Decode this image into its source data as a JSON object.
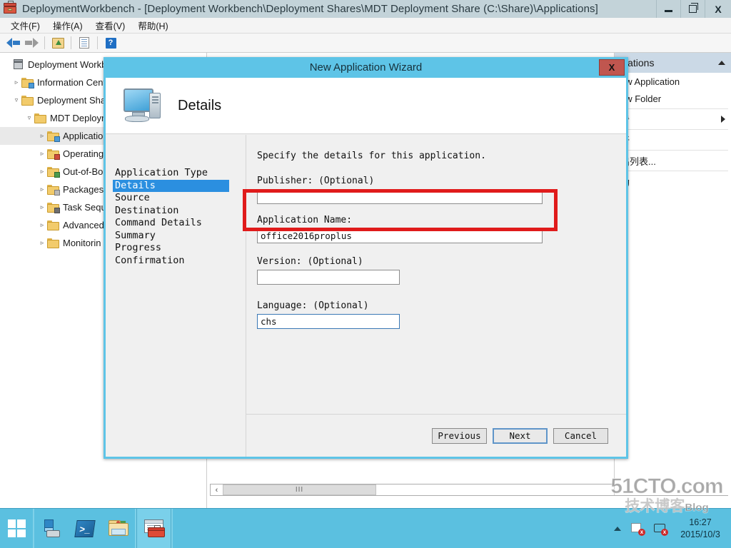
{
  "window": {
    "title": "DeploymentWorkbench - [Deployment Workbench\\Deployment Shares\\MDT Deployment Share (C:\\Share)\\Applications]",
    "icon": "toolbox-icon",
    "buttons": {
      "minimize": "–",
      "restore": "❐",
      "close": "X"
    }
  },
  "menubar": {
    "items": [
      {
        "label": "文件(F)"
      },
      {
        "label": "操作(A)"
      },
      {
        "label": "查看(V)"
      },
      {
        "label": "帮助(H)"
      }
    ]
  },
  "toolbar": {
    "buttons": [
      {
        "name": "back-icon"
      },
      {
        "name": "forward-icon"
      },
      {
        "name": "up-folder-icon"
      },
      {
        "name": "properties-icon"
      },
      {
        "name": "help-icon",
        "label": "?"
      }
    ]
  },
  "tree": {
    "nodes": [
      {
        "label": "Deployment Workb",
        "indent": 0,
        "twisty": "",
        "icon": "workbench-root-icon",
        "selected": false
      },
      {
        "label": "Information Cent",
        "indent": 1,
        "twisty": "▹",
        "icon": "folder-info-icon",
        "selected": false
      },
      {
        "label": "Deployment Sha",
        "indent": 1,
        "twisty": "▿",
        "icon": "folder-icon",
        "selected": false
      },
      {
        "label": "MDT Deploym",
        "indent": 2,
        "twisty": "▿",
        "icon": "folder-icon",
        "selected": false
      },
      {
        "label": "Applicatio",
        "indent": 3,
        "twisty": "▹",
        "icon": "folder-apps-icon",
        "selected": true
      },
      {
        "label": "Operating",
        "indent": 3,
        "twisty": "▹",
        "icon": "folder-os-icon",
        "selected": false
      },
      {
        "label": "Out-of-Bo",
        "indent": 3,
        "twisty": "▹",
        "icon": "folder-drivers-icon",
        "selected": false
      },
      {
        "label": "Packages",
        "indent": 3,
        "twisty": "▹",
        "icon": "folder-packages-icon",
        "selected": false
      },
      {
        "label": "Task Sequ",
        "indent": 3,
        "twisty": "▹",
        "icon": "folder-taskseq-icon",
        "selected": false
      },
      {
        "label": "Advanced",
        "indent": 3,
        "twisty": "▹",
        "icon": "folder-plain-icon",
        "selected": false
      },
      {
        "label": "Monitorin",
        "indent": 3,
        "twisty": "▹",
        "icon": "folder-plain-icon",
        "selected": false
      }
    ]
  },
  "actions_pane": {
    "header": "ications",
    "collapse_icon": "caret-up-icon",
    "items": [
      {
        "label": "ew Application",
        "submenu": false
      },
      {
        "label": "ew Folder",
        "submenu": false
      },
      {
        "label": "看",
        "submenu": true
      },
      {
        "label": "新",
        "submenu": false
      },
      {
        "label": "出列表...",
        "submenu": false
      },
      {
        "label": "助",
        "submenu": false
      }
    ]
  },
  "list_pane": {
    "scrollbar": {
      "left_arrow": "‹",
      "right_arrow": "›",
      "thumb_grip": "III"
    }
  },
  "wizard": {
    "title": "New Application Wizard",
    "close_label": "X",
    "banner_title": "Details",
    "banner_icon": "computer-icon",
    "steps": [
      {
        "label": "Application Type",
        "active": false
      },
      {
        "label": "Details",
        "active": true
      },
      {
        "label": "Source",
        "active": false
      },
      {
        "label": "Destination",
        "active": false
      },
      {
        "label": "Command Details",
        "active": false
      },
      {
        "label": "Summary",
        "active": false
      },
      {
        "label": "Progress",
        "active": false
      },
      {
        "label": "Confirmation",
        "active": false
      }
    ],
    "intro": "Specify the details for this application.",
    "fields": [
      {
        "label": "Publisher: (Optional)",
        "value": "",
        "placeholder": "",
        "focused": false,
        "width": "wide"
      },
      {
        "label": "Application Name:",
        "value": "office2016proplus",
        "placeholder": "",
        "focused": false,
        "width": "wide"
      },
      {
        "label": "Version: (Optional)",
        "value": "",
        "placeholder": "",
        "focused": false,
        "width": "mid"
      },
      {
        "label": "Language: (Optional)",
        "value": "chs",
        "placeholder": "",
        "focused": true,
        "width": "mid"
      }
    ],
    "buttons": {
      "previous": "Previous",
      "next": "Next",
      "cancel": "Cancel"
    },
    "annotation": {
      "color": "#e01b1b",
      "target": "application-name-field"
    }
  },
  "taskbar": {
    "start_icon": "windows-logo-icon",
    "items": [
      {
        "name": "server-manager-icon",
        "active": false
      },
      {
        "name": "powershell-icon",
        "active": false,
        "label": ">_"
      },
      {
        "name": "file-explorer-icon",
        "active": false
      },
      {
        "name": "deployment-workbench-icon",
        "active": true
      }
    ],
    "tray": {
      "overflow_icon": "caret-up-icon",
      "icons": [
        "flag-action-center-icon",
        "network-icon"
      ],
      "time": "16:27",
      "date": "2015/10/3"
    }
  },
  "watermark": {
    "top": "51CTO.com",
    "bottom_cn": "技术博客",
    "bottom_en": "Blog"
  }
}
